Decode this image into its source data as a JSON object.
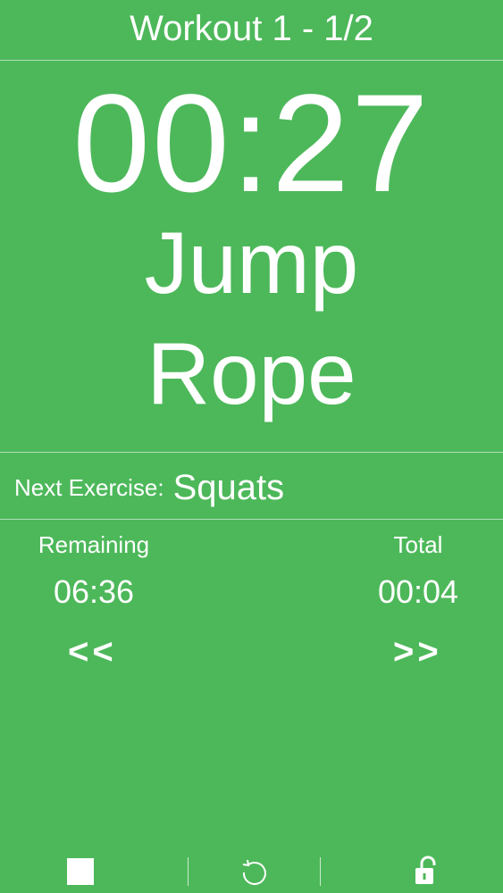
{
  "header": {
    "title": "Workout 1 - 1/2"
  },
  "timer": {
    "value": "00:27"
  },
  "current_exercise": {
    "line1": "Jump",
    "line2": "Rope"
  },
  "next": {
    "label": "Next Exercise:",
    "value": "Squats"
  },
  "stats": {
    "remaining_label": "Remaining",
    "remaining_value": "06:36",
    "total_label": "Total",
    "total_value": "00:04"
  },
  "navigation": {
    "previous_label": "<<",
    "next_label": ">>"
  },
  "toolbar": {
    "stop_icon": "stop-icon",
    "restart_icon": "restart-icon",
    "lock_icon": "unlock-icon"
  },
  "colors": {
    "background": "#4db85a",
    "foreground": "#ffffff"
  }
}
